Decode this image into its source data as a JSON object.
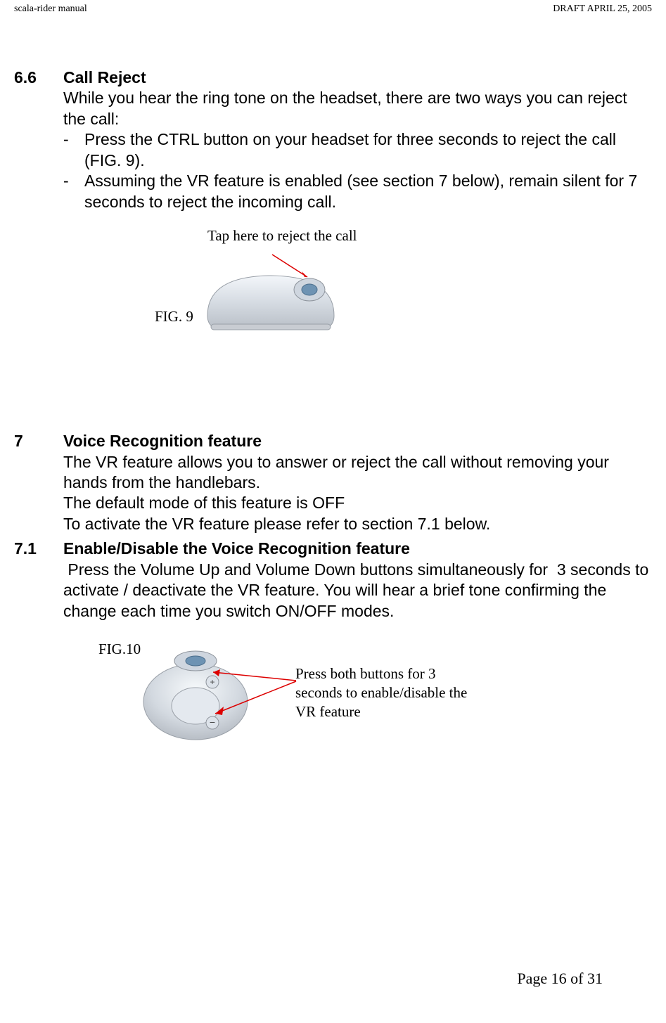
{
  "header": {
    "left": "scala-rider manual",
    "right": "DRAFT  APRIL 25, 2005"
  },
  "section66": {
    "number": "6.6",
    "title": "Call Reject",
    "intro": "While you hear the ring tone on the headset, there are two ways you can reject the call:",
    "bullet1": "Press the CTRL button on your headset for three seconds to reject the call (FIG. 9).",
    "bullet2": "Assuming the VR feature is enabled (see section 7 below), remain silent for 7 seconds to reject the incoming call."
  },
  "fig9": {
    "caption": "Tap here to reject the call",
    "label": "FIG. 9"
  },
  "section7": {
    "number": "7",
    "title": "Voice Recognition feature",
    "line1": "The VR feature allows you to answer or reject the call without removing your hands from the handlebars.",
    "line2": "The default mode of this feature is OFF",
    "line3": "To activate the VR feature please refer to section 7.1 below."
  },
  "section71": {
    "number": "7.1",
    "title": "Enable/Disable the Voice Recognition feature",
    "body": " Press the Volume Up and Volume Down buttons simultaneously for  3 seconds to activate / deactivate the VR feature. You will hear a brief tone confirming the change each time you switch ON/OFF modes."
  },
  "fig10": {
    "label": "FIG.10",
    "caption": "Press both buttons for 3 seconds to enable/disable the VR feature"
  },
  "footer": {
    "page": "Page 16 of 31"
  }
}
